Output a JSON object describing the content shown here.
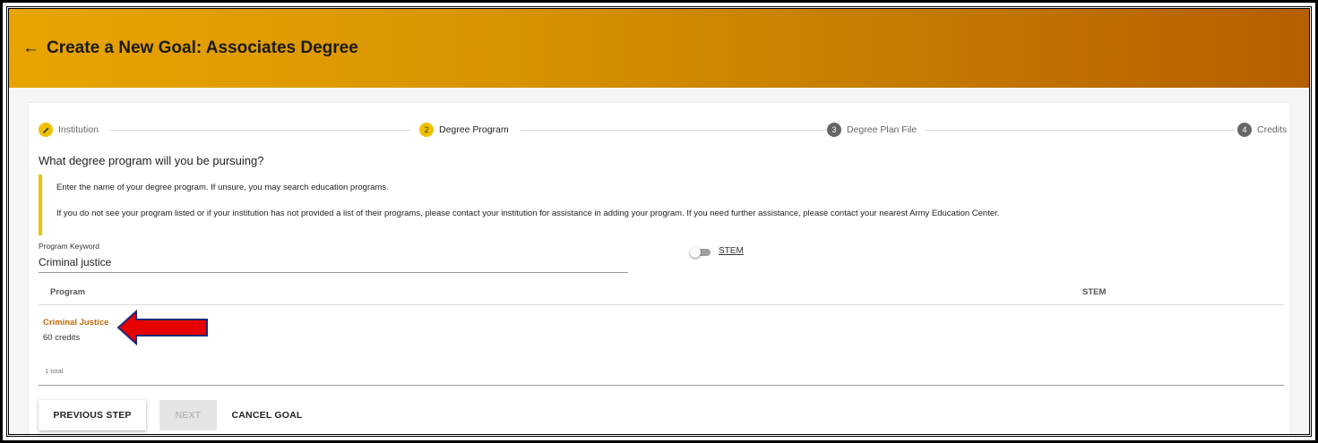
{
  "header": {
    "back_icon": "←",
    "title": "Create a New Goal: Associates Degree"
  },
  "stepper": {
    "steps": [
      {
        "number": "",
        "icon": "pencil-icon",
        "label": "Institution",
        "state": "completed"
      },
      {
        "number": "2",
        "label": "Degree Program",
        "state": "active"
      },
      {
        "number": "3",
        "label": "Degree Plan File",
        "state": "pending"
      },
      {
        "number": "4",
        "label": "Credits",
        "state": "pending"
      }
    ]
  },
  "question": "What degree program will you be pursuing?",
  "callout": {
    "line1": "Enter the name of your degree program. If unsure, you may search education programs.",
    "line2": "If you do not see your program listed or if your institution has not provided a list of their programs, please contact your institution for assistance in adding your program. If you need further assistance, please contact your nearest Army Education Center."
  },
  "search": {
    "label": "Program Keyword",
    "value": "Criminal justice"
  },
  "stem_toggle": {
    "label": "STEM",
    "on": false
  },
  "table": {
    "headers": [
      "Program",
      "STEM"
    ],
    "rows": [
      {
        "program": "Criminal Justice",
        "credits": "60 credits",
        "stem": ""
      }
    ],
    "total": "1 total"
  },
  "buttons": {
    "previous": "PREVIOUS STEP",
    "next": "NEXT",
    "cancel": "CANCEL GOAL"
  },
  "colors": {
    "header_start": "#e8a400",
    "header_end": "#b55f00",
    "accent_yellow": "#f0c000",
    "link_orange": "#c7680a",
    "arrow_red": "#e60000",
    "arrow_border": "#1f2a7a"
  }
}
